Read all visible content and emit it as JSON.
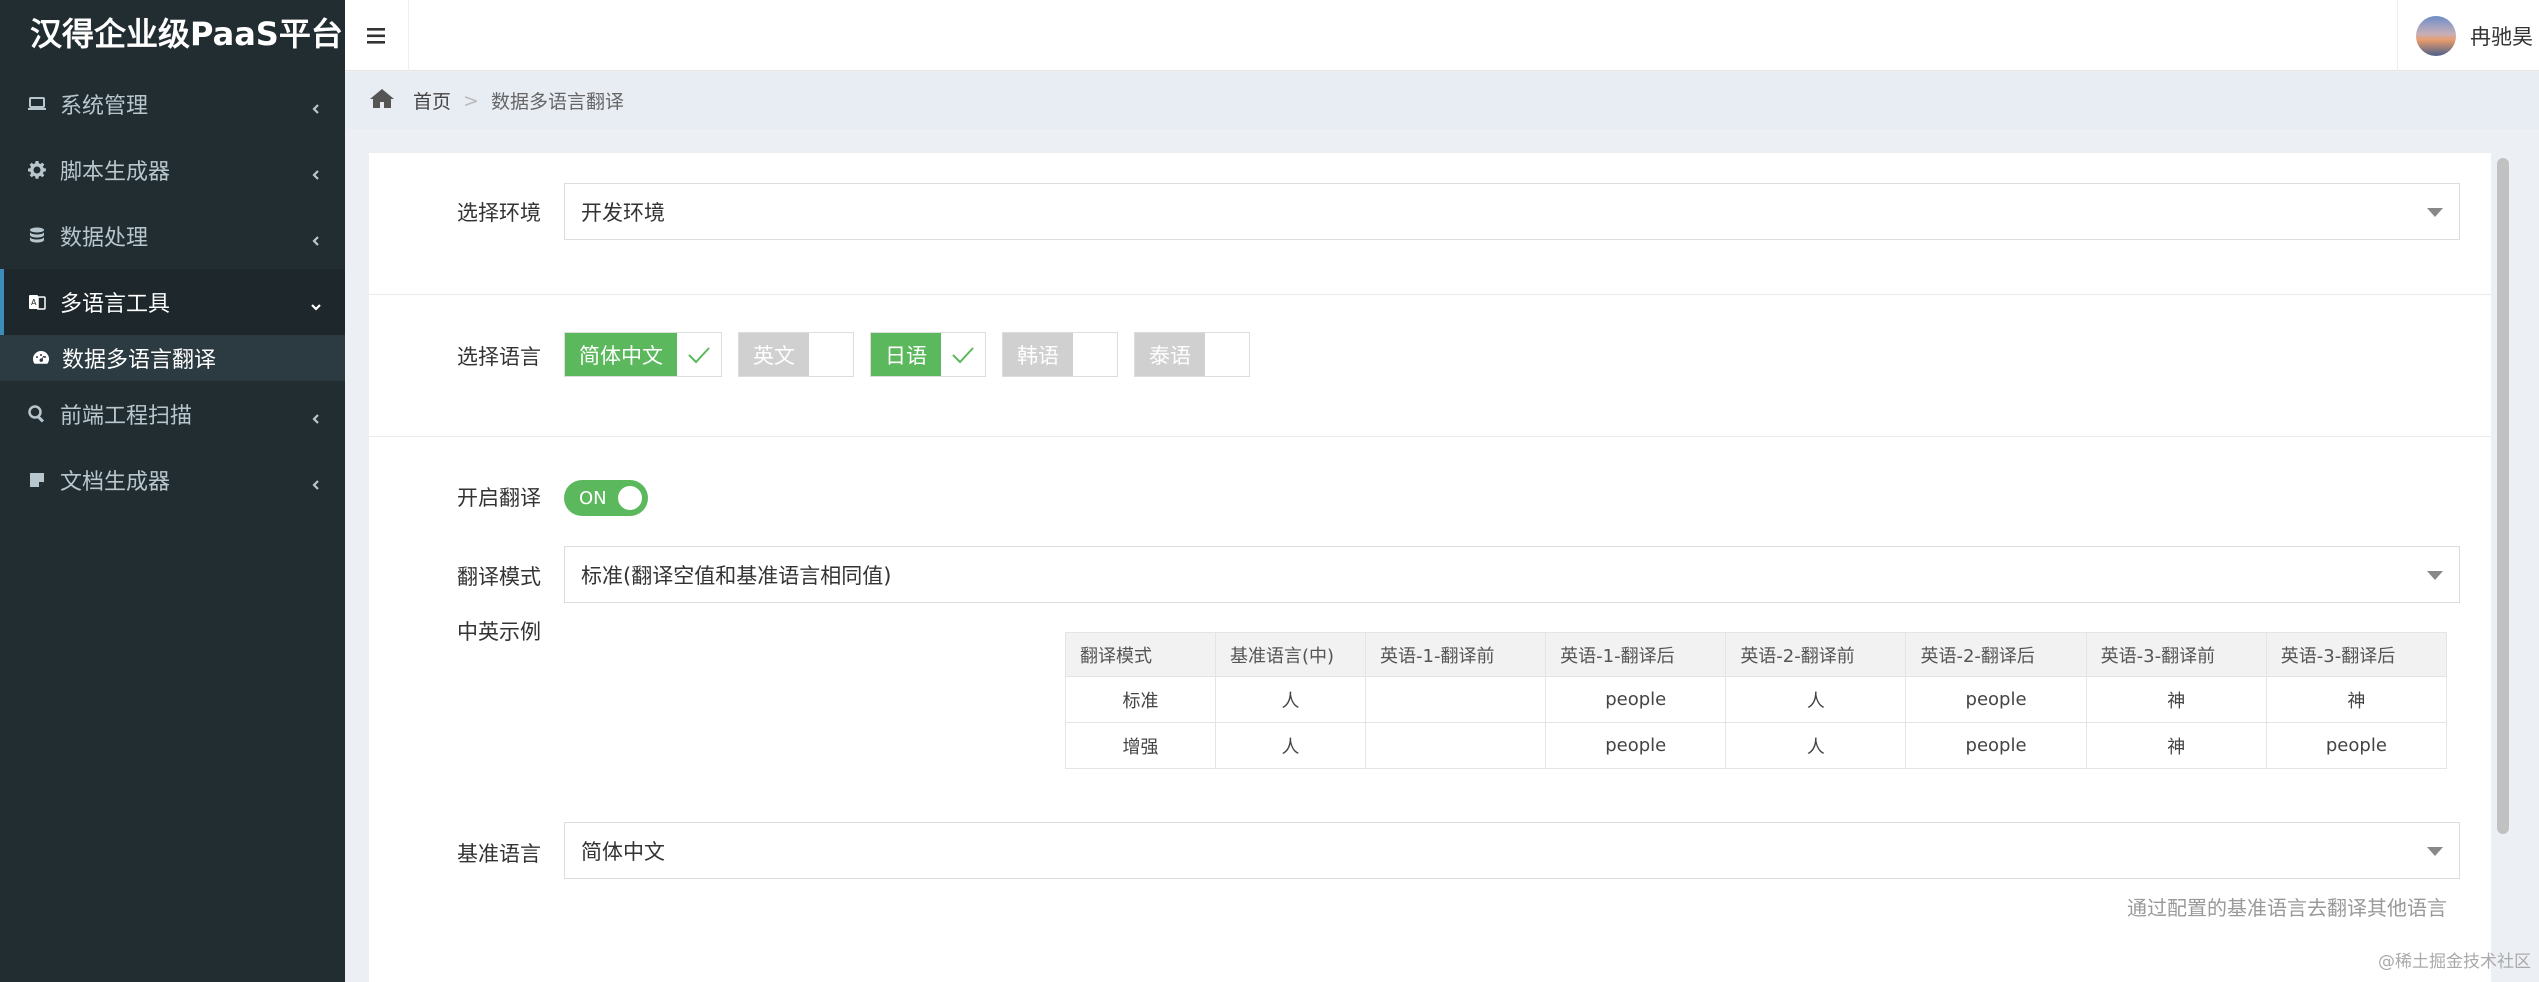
{
  "app": {
    "title": "汉得企业级PaaS平台"
  },
  "sidebar": {
    "items": [
      {
        "label": "系统管理"
      },
      {
        "label": "脚本生成器"
      },
      {
        "label": "数据处理"
      },
      {
        "label": "多语言工具"
      },
      {
        "label": "数据多语言翻译"
      },
      {
        "label": "前端工程扫描"
      },
      {
        "label": "文档生成器"
      }
    ]
  },
  "header": {
    "username": "冉驰昊"
  },
  "breadcrumb": {
    "home": "首页",
    "separator": ">",
    "current": "数据多语言翻译"
  },
  "form": {
    "env_label": "选择环境",
    "env_value": "开发环境",
    "lang_label": "选择语言",
    "languages": [
      {
        "name": "简体中文",
        "checked": true
      },
      {
        "name": "英文",
        "checked": false
      },
      {
        "name": "日语",
        "checked": true
      },
      {
        "name": "韩语",
        "checked": false
      },
      {
        "name": "泰语",
        "checked": false
      }
    ],
    "translate_label": "开启翻译",
    "translate_toggle": "ON",
    "mode_label": "翻译模式",
    "mode_value": "标准(翻译空值和基准语言相同值)",
    "example_label": "中英示例",
    "base_label": "基准语言",
    "base_value": "简体中文",
    "base_hint": "通过配置的基准语言去翻译其他语言"
  },
  "example_table": {
    "headers": [
      "翻译模式",
      "基准语言(中)",
      "英语-1-翻译前",
      "英语-1-翻译后",
      "英语-2-翻译前",
      "英语-2-翻译后",
      "英语-3-翻译前",
      "英语-3-翻译后"
    ],
    "rows": [
      [
        "标准",
        "人",
        "",
        "people",
        "人",
        "people",
        "神",
        "神"
      ],
      [
        "增强",
        "人",
        "",
        "people",
        "人",
        "people",
        "神",
        "people"
      ]
    ]
  },
  "watermark": "@稀土掘金技术社区",
  "colors": {
    "sidebar_bg": "#222d32",
    "accent_green": "#5cb85c",
    "active_border": "#3c8dbc"
  }
}
